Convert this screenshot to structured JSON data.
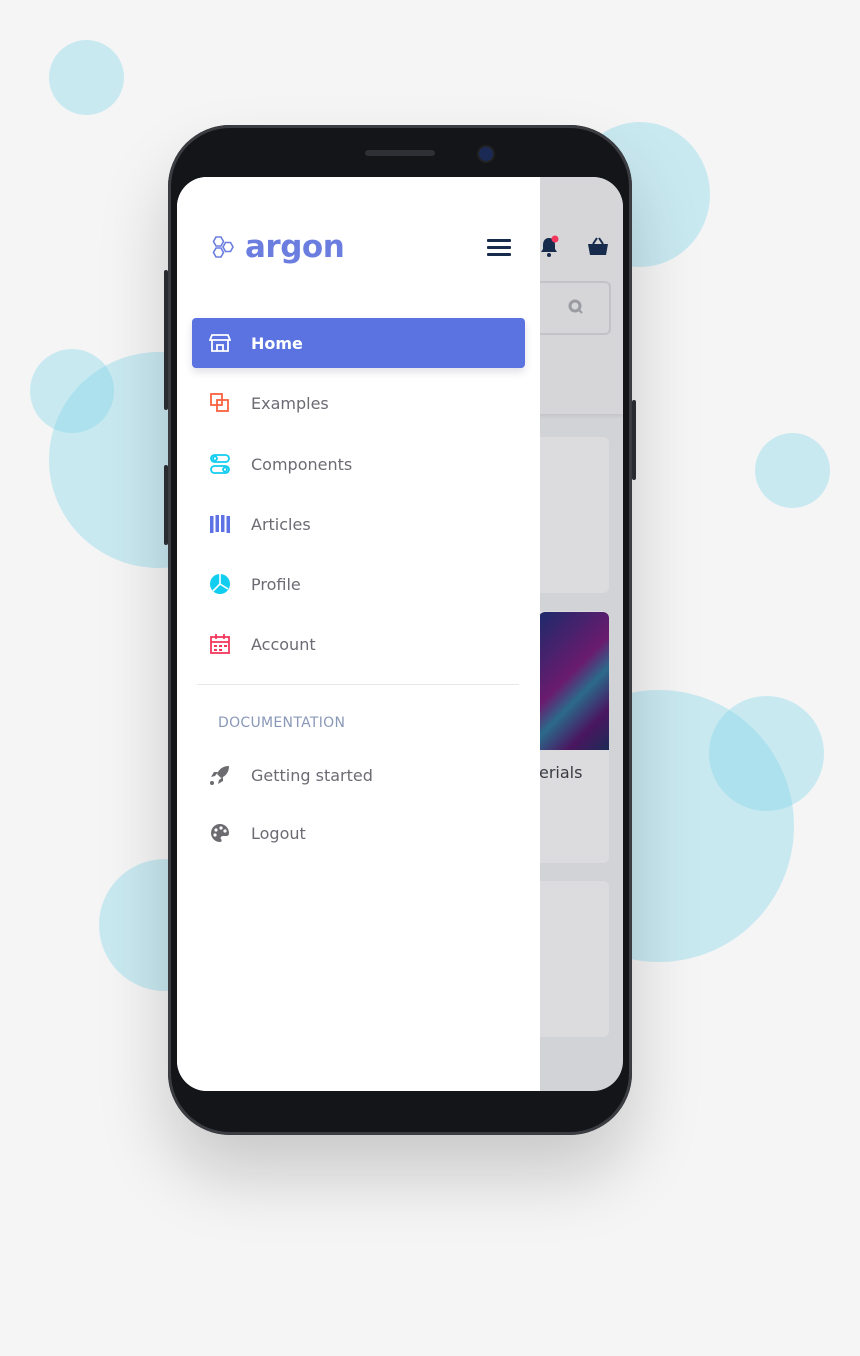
{
  "app": {
    "logo_text": "argon",
    "accent_color": "#5b73e1"
  },
  "drawer": {
    "items": [
      {
        "label": "Home",
        "icon": "shop-icon",
        "active": true
      },
      {
        "label": "Examples",
        "icon": "squares-icon",
        "color": "#fb6340"
      },
      {
        "label": "Components",
        "icon": "toggles-icon",
        "color": "#11cdef"
      },
      {
        "label": "Articles",
        "icon": "columns-icon",
        "color": "#5e72e4"
      },
      {
        "label": "Profile",
        "icon": "pie-chart-icon",
        "color": "#11cdef"
      },
      {
        "label": "Account",
        "icon": "calendar-icon",
        "color": "#f5365c"
      }
    ],
    "section_label": "DOCUMENTATION",
    "doc_items": [
      {
        "label": "Getting started",
        "icon": "rocket-icon"
      },
      {
        "label": "Logout",
        "icon": "palette-icon"
      }
    ]
  },
  "background_screen": {
    "card_text_partial": "erials",
    "notification_color": "#f5365c"
  }
}
